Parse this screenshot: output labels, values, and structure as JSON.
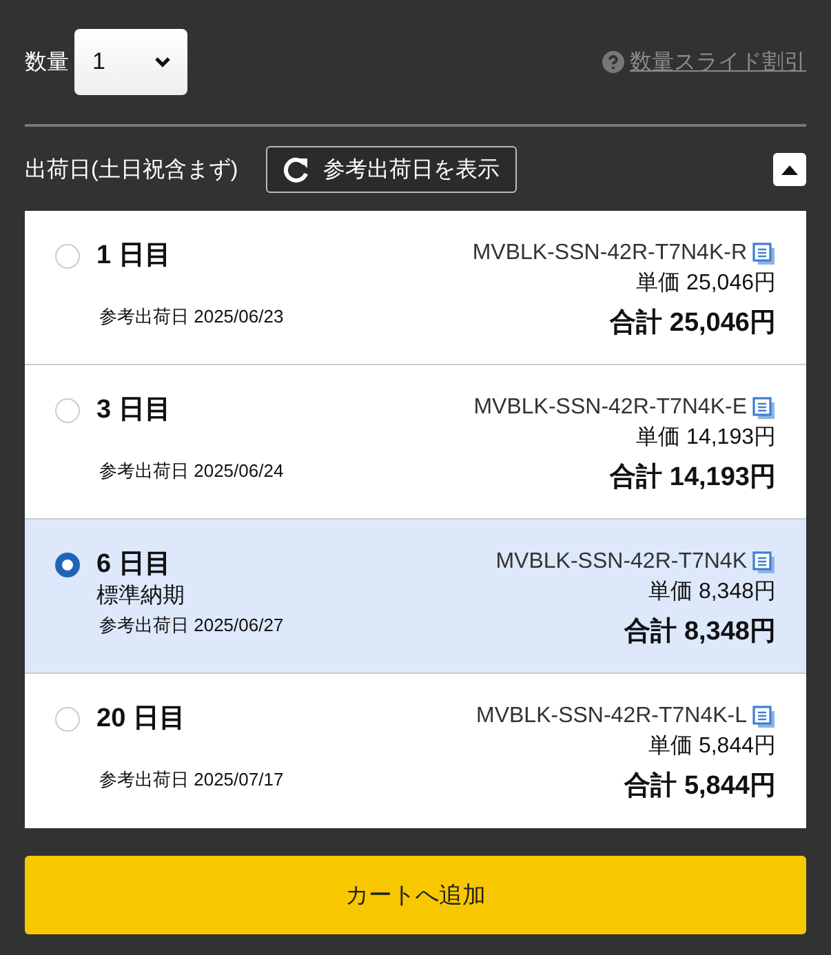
{
  "quantity": {
    "label": "数量",
    "value": "1"
  },
  "discount_link": "数量スライド割引",
  "shipping": {
    "label": "出荷日(土日祝含まず)",
    "button": "参考出荷日を表示",
    "expanded": true
  },
  "options": [
    {
      "title": "1 日目",
      "date": "参考出荷日 2025/06/23",
      "code": "MVBLK-SSN-42R-T7N4K-R",
      "unit_price": "単価 25,046円",
      "total": "合計 25,046円",
      "selected": false
    },
    {
      "title": "3 日目",
      "date": "参考出荷日 2025/06/24",
      "code": "MVBLK-SSN-42R-T7N4K-E",
      "unit_price": "単価 14,193円",
      "total": "合計 14,193円",
      "selected": false
    },
    {
      "title": "6 日目",
      "note": "標準納期",
      "date": "参考出荷日 2025/06/27",
      "code": "MVBLK-SSN-42R-T7N4K",
      "unit_price": "単価 8,348円",
      "total": "合計 8,348円",
      "selected": true
    },
    {
      "title": "20 日目",
      "date": "参考出荷日 2025/07/17",
      "code": "MVBLK-SSN-42R-T7N4K-L",
      "unit_price": "単価 5,844円",
      "total": "合計 5,844円",
      "selected": false
    }
  ],
  "add_to_cart": "カートへ追加"
}
